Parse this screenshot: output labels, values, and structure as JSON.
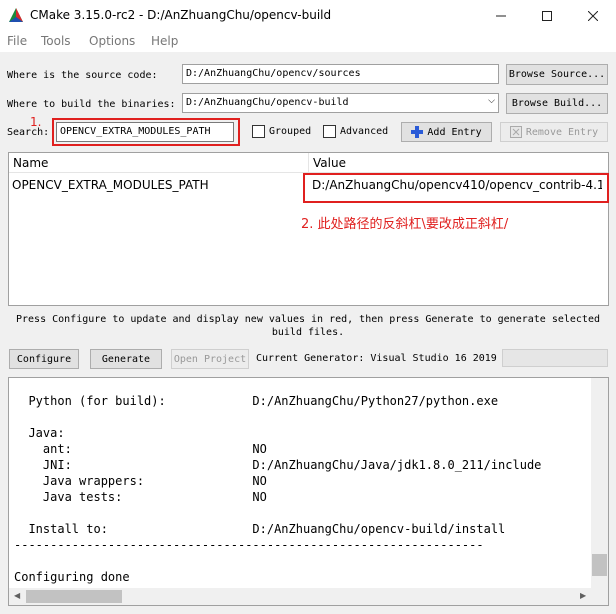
{
  "window": {
    "title": "CMake 3.15.0-rc2 - D:/AnZhuangChu/opencv-build"
  },
  "menu": [
    "File",
    "Tools",
    "Options",
    "Help"
  ],
  "source": {
    "label": "Where is the source code:",
    "value": "D:/AnZhuangChu/opencv/sources",
    "browse": "Browse Source..."
  },
  "build": {
    "label": "Where to build the binaries:",
    "value": "D:/AnZhuangChu/opencv-build",
    "browse": "Browse Build..."
  },
  "search": {
    "label": "Search:",
    "value": "OPENCV_EXTRA_MODULES_PATH",
    "annotation": "1.",
    "grouped": "Grouped",
    "advanced": "Advanced",
    "add_entry": "Add Entry",
    "remove_entry": "Remove Entry"
  },
  "table": {
    "headers": [
      "Name",
      "Value"
    ],
    "rows": [
      {
        "name": "OPENCV_EXTRA_MODULES_PATH",
        "value": "D:/AnZhuangChu/opencv410/opencv_contrib-4.1...."
      }
    ],
    "annotation": "2. 此处路径的反斜杠\\要改成正斜杠/"
  },
  "hint": "Press Configure to update and display new values in red, then press Generate to generate selected build files.",
  "actions": {
    "configure": "Configure",
    "generate": "Generate",
    "open_project": "Open Project",
    "generator_label": "Current Generator: Visual Studio 16 2019"
  },
  "output_lines": [
    "  Python (for build):            D:/AnZhuangChu/Python27/python.exe",
    "",
    "  Java:",
    "    ant:                         NO",
    "    JNI:                         D:/AnZhuangChu/Java/jdk1.8.0_211/include",
    "    Java wrappers:               NO",
    "    Java tests:                  NO",
    "",
    "  Install to:                    D:/AnZhuangChu/opencv-build/install",
    "-----------------------------------------------------------------",
    "",
    "Configuring done"
  ],
  "colors": {
    "annotation": "#e0201f",
    "add_icon": "#2a5bd7"
  }
}
